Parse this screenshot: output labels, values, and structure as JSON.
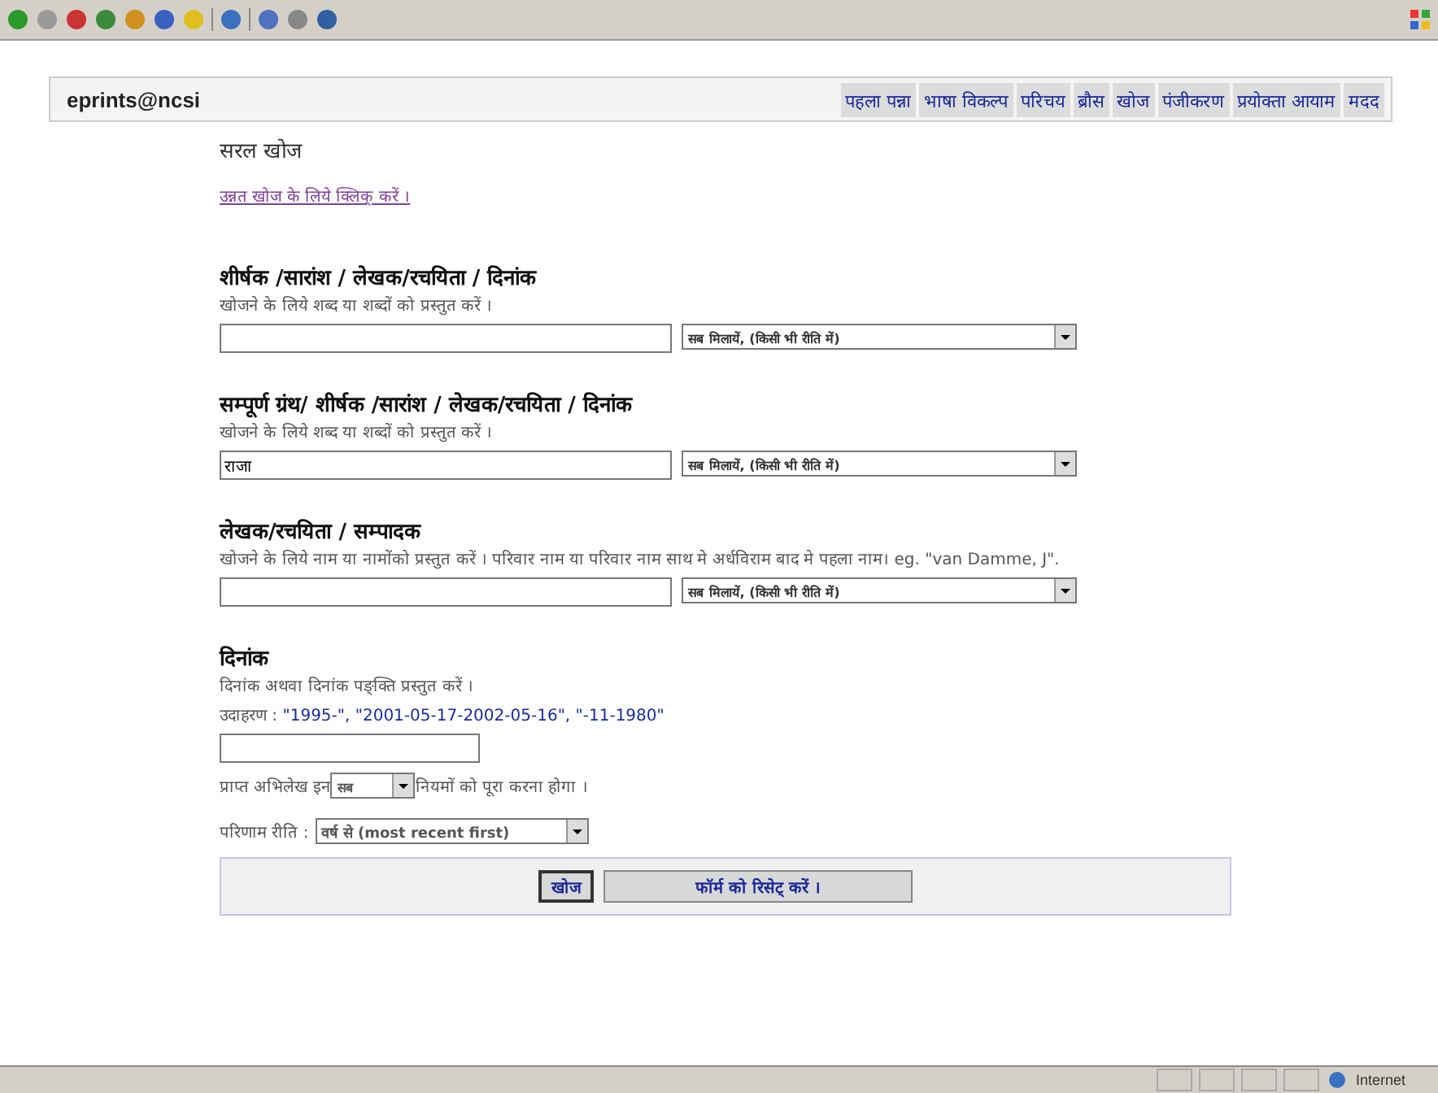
{
  "site": {
    "title": "eprints@ncsi"
  },
  "nav": [
    {
      "label": "पहला पन्ना"
    },
    {
      "label": "भाषा विकल्प"
    },
    {
      "label": "परिचय"
    },
    {
      "label": "ब्रौस"
    },
    {
      "label": "खोज"
    },
    {
      "label": "पंजीकरण"
    },
    {
      "label": "प्रयोक्ता आयाम"
    },
    {
      "label": "मदद"
    }
  ],
  "page_title": "सरल खोज",
  "advanced_link": "उन्नत खोज के लिये क्लिक् करें ।",
  "sections": [
    {
      "kind": "text",
      "heading": "शीर्षक /सारांश / लेखक/रचयिता / दिनांक",
      "help": "खोजने के लिये शब्द या शब्दों को प्रस्तुत करें ।",
      "match": "सब मिलायें, (किसी भी रीति में)"
    },
    {
      "kind": "text",
      "heading": "सम्पूर्ण ग्रंथ/ शीर्षक /सारांश / लेखक/रचयिता / दिनांक",
      "help": "खोजने के लिये शब्द या शब्दों को प्रस्तुत करें ।",
      "value": "राजा",
      "match": "सब मिलायें, (किसी भी रीति में)"
    },
    {
      "kind": "text",
      "heading": "लेखक/रचयिता / सम्पादक",
      "help": "खोजने के लिये नाम या नामोंको प्रस्तुत करें । परिवार नाम या परिवार नाम साथ मे अर्धविराम बाद मे पहला नाम। eg. \"van Damme, J\".",
      "match": "सब मिलायें, (किसी भी रीति में)"
    },
    {
      "kind": "date",
      "heading": "दिनांक",
      "help": "दिनांक अथवा दिनांक पङ्क्ति प्रस्तुत करें ।",
      "example_label": "उदाहरण :",
      "examples": [
        "\"1995-\",",
        "\"2001-05-17-2002-05-16\",",
        "\"-11-1980\""
      ]
    }
  ],
  "satisfy": {
    "before": "प्राप्त अभिलेख इन",
    "value": "सब",
    "after": "नियमों को पूरा करना होगा ।"
  },
  "order": {
    "label": "परिणाम रीति :",
    "value": "वर्ष से (most recent first)"
  },
  "buttons": [
    {
      "label": "खोज"
    },
    {
      "label": "फॉर्म को रिसेट् करें ।"
    }
  ],
  "status_bar": {
    "zone": "Internet"
  }
}
